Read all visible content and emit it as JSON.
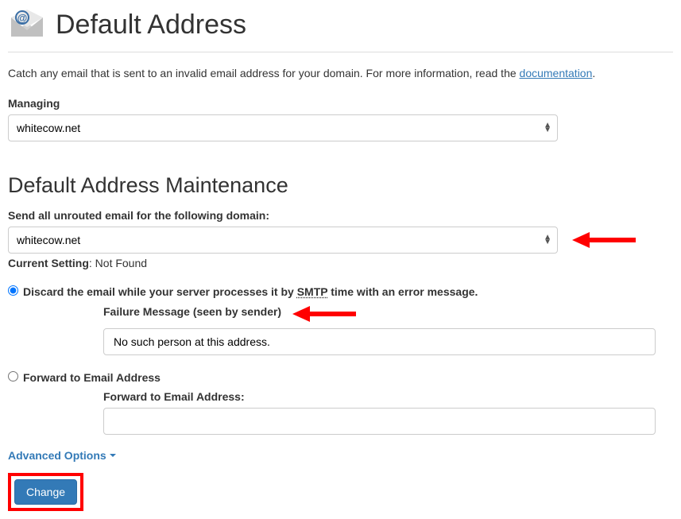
{
  "header": {
    "title": "Default Address"
  },
  "intro": {
    "text_prefix": "Catch any email that is sent to an invalid email address for your domain. For more information, read the ",
    "link_text": "documentation",
    "text_suffix": "."
  },
  "managing": {
    "label": "Managing",
    "value": "whitecow.net"
  },
  "maintenance": {
    "title": "Default Address Maintenance",
    "domain_label": "Send all unrouted email for the following domain:",
    "domain_value": "whitecow.net",
    "current_setting_label": "Current Setting",
    "current_setting_value": ": Not Found"
  },
  "discard_option": {
    "label_prefix": "Discard the email while your server processes it by ",
    "smtp": "SMTP",
    "label_suffix": " time with an error message.",
    "failure_label": "Failure Message (seen by sender)",
    "failure_value": "No such person at this address."
  },
  "forward_option": {
    "label": "Forward to Email Address",
    "sub_label": "Forward to Email Address:",
    "value": ""
  },
  "advanced": {
    "label": "Advanced Options"
  },
  "submit": {
    "label": "Change"
  }
}
